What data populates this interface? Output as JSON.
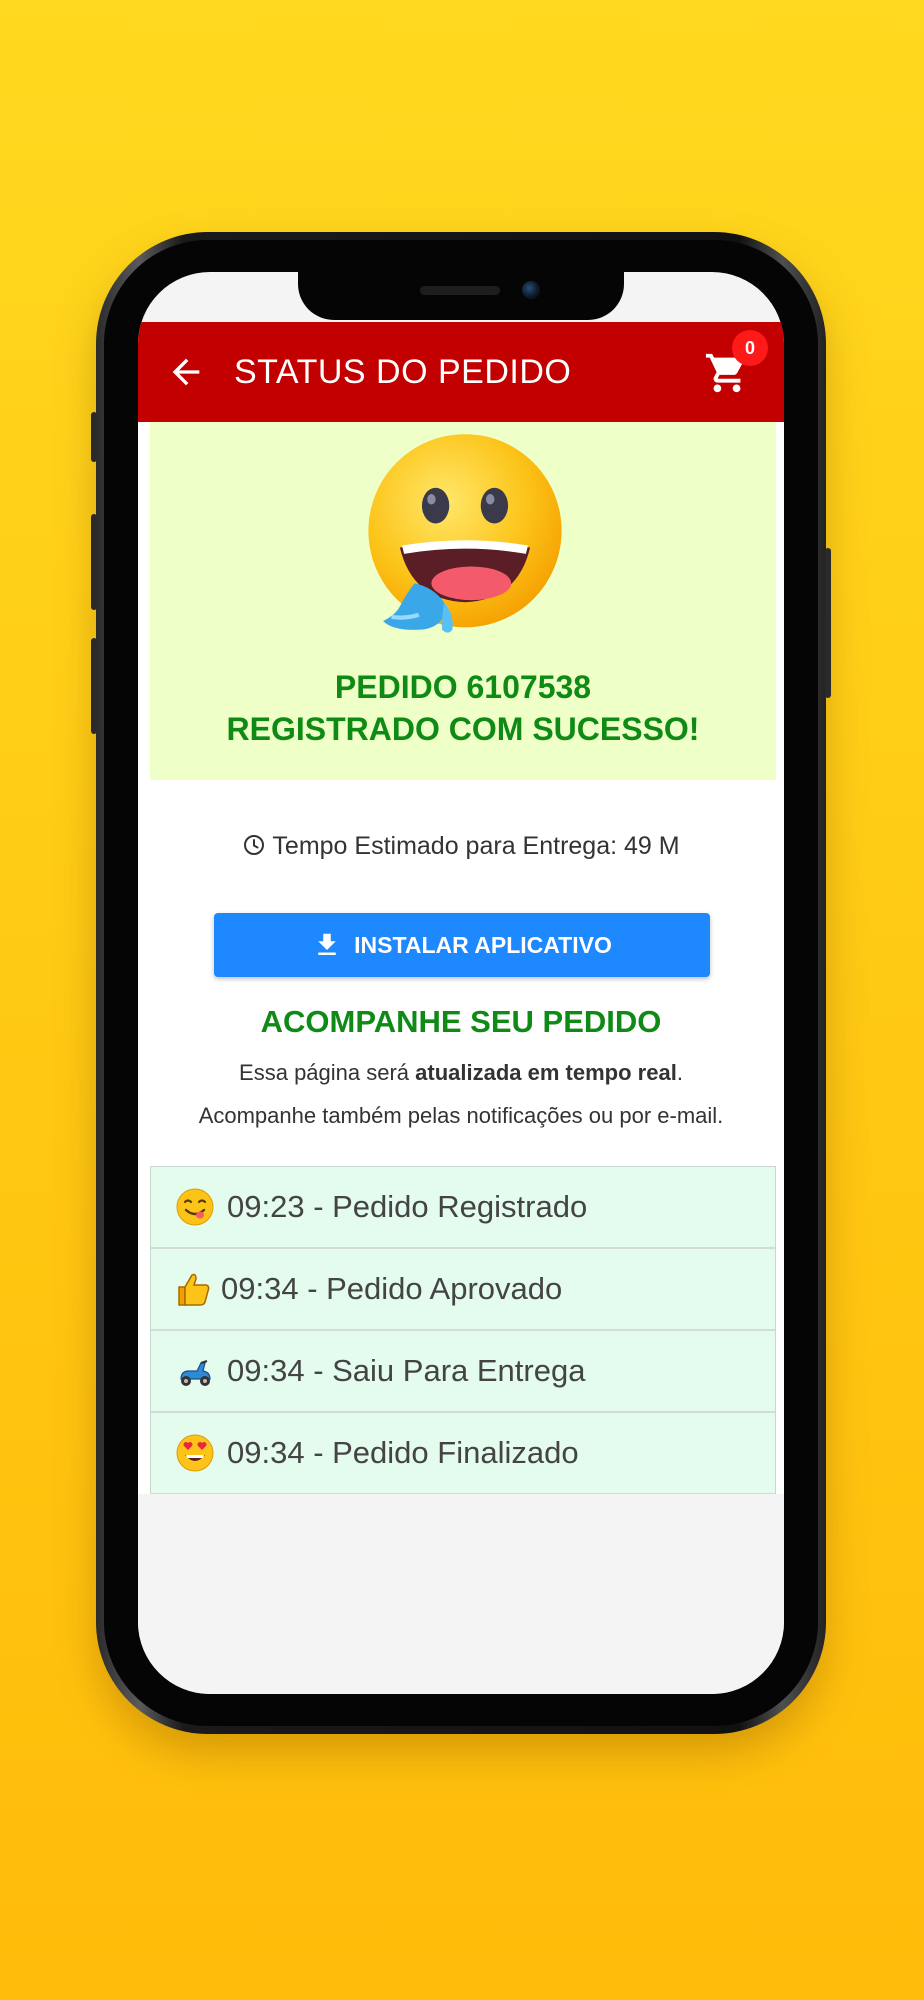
{
  "app_bar": {
    "title": "STATUS DO PEDIDO",
    "cart_count": "0",
    "background": "#c20000"
  },
  "hero": {
    "emoji": "drooling-face-icon",
    "order_line": "PEDIDO 6107538",
    "success_line": "REGISTRADO COM SUCESSO!"
  },
  "eta": {
    "icon": "clock-icon",
    "text": "Tempo Estimado para Entrega: 49 M"
  },
  "install_button": {
    "icon": "download-icon",
    "label": "INSTALAR APLICATIVO",
    "color": "#1e88ff"
  },
  "follow": {
    "title": "ACOMPANHE SEU PEDIDO",
    "line1_prefix": "Essa página será ",
    "line1_bold": "atualizada em tempo real",
    "line1_suffix": ".",
    "line2": "Acompanhe também pelas notificações ou por e-mail."
  },
  "status_steps": [
    {
      "icon": "yum-face-icon",
      "text": "09:23 - Pedido Registrado"
    },
    {
      "icon": "thumbs-up-icon",
      "text": "09:34 - Pedido Aprovado"
    },
    {
      "icon": "scooter-icon",
      "text": "09:34 - Saiu Para Entrega"
    },
    {
      "icon": "heart-eyes-face-icon",
      "text": "09:34 - Pedido Finalizado"
    }
  ]
}
